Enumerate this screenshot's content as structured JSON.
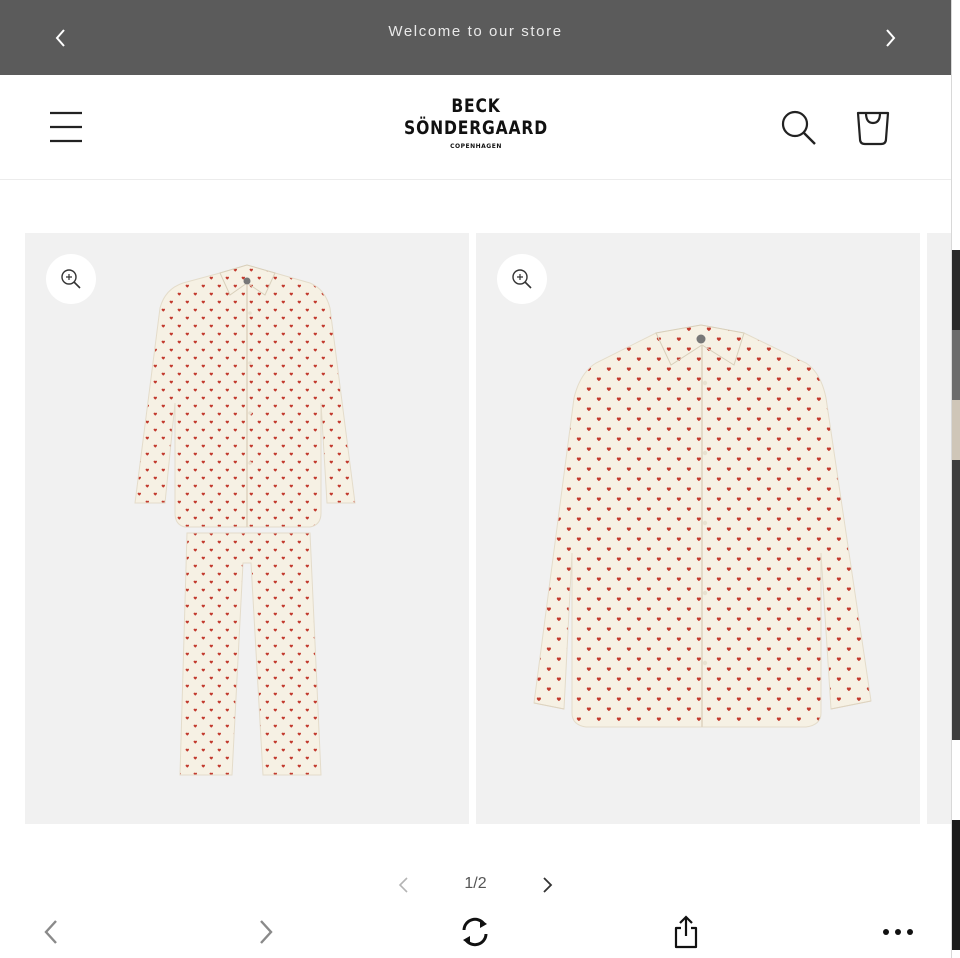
{
  "announcement": {
    "message": "Welcome to our store",
    "prev_icon": "chevron-left-icon",
    "next_icon": "chevron-right-icon"
  },
  "header": {
    "logo": {
      "line1": "BECK",
      "line2": "SÖNDERGAARD",
      "line3": "COPENHAGEN"
    },
    "menu_icon": "hamburger-icon",
    "search_icon": "search-icon",
    "cart_icon": "cart-icon"
  },
  "gallery": {
    "slides": [
      {
        "subject": "pajama-set",
        "zoom_icon": "zoom-in-icon"
      },
      {
        "subject": "pajama-shirt",
        "zoom_icon": "zoom-in-icon"
      }
    ],
    "pagination": {
      "current": 1,
      "total": 2,
      "label": "1/2"
    }
  },
  "browser_toolbar": {
    "icons": [
      "back-icon",
      "forward-icon",
      "reload-icon",
      "share-icon",
      "more-icon"
    ]
  },
  "colors": {
    "announcement_bg": "#5b5b5b",
    "announcement_text": "#e9e9e9",
    "fabric": "#f6f1e4",
    "print": "#c23a2e",
    "image_bg": "#f1f1f1"
  }
}
